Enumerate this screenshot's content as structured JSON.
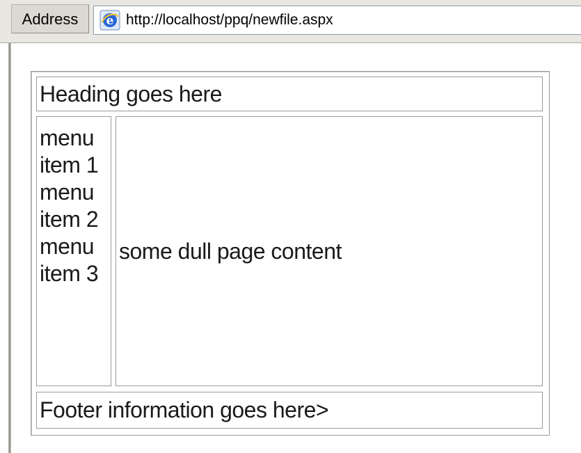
{
  "browser": {
    "address_label": "Address",
    "url": "http://localhost/ppq/newfile.aspx",
    "page_icon": "ie-page-icon"
  },
  "page": {
    "heading": "Heading goes here",
    "menu_items": [
      {
        "label": "menu item 1"
      },
      {
        "label": "menu item 2"
      },
      {
        "label": "menu item 3"
      }
    ],
    "content": "some dull page content",
    "footer": "Footer information goes here>"
  }
}
